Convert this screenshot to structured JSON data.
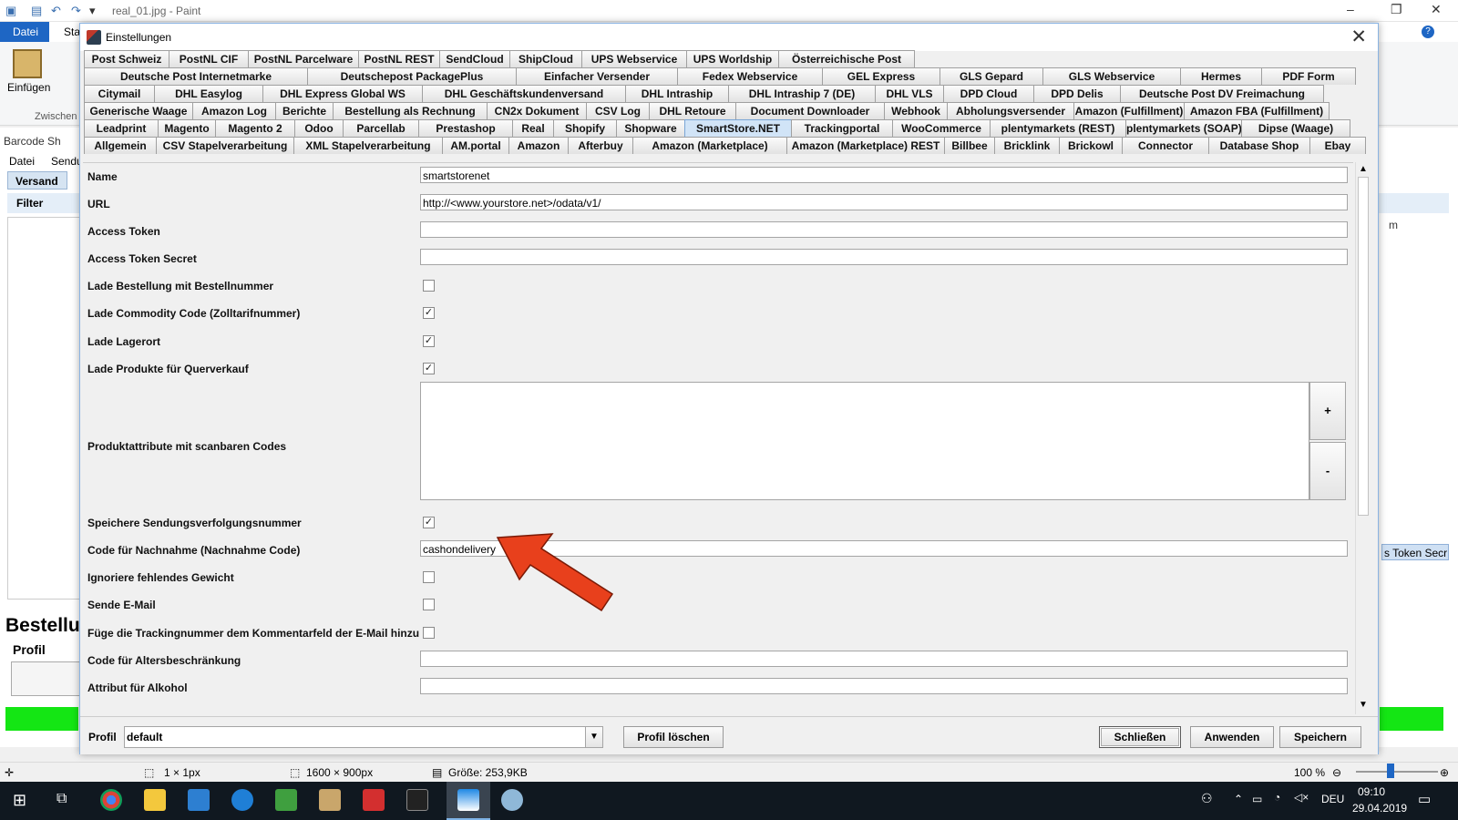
{
  "paint": {
    "window_title": "real_01.jpg - Paint",
    "file_tab": "Datei",
    "start_tab": "Sta",
    "paste_label": "Einfügen",
    "clipboard_group": "Zwischen",
    "status": {
      "selection": "1 × 1px",
      "image_size": "1600 × 900px",
      "file_size": "Größe: 253,9KB",
      "zoom": "100 %"
    }
  },
  "background_app": {
    "title": "Barcode Sh",
    "menu": [
      "Datei",
      "Sendu"
    ],
    "tab_versand": "Versand",
    "filter_label": "Filter",
    "heading": "Bestellu",
    "profil_label": "Profil",
    "token_field_fragment": "s Token Secr",
    "column_fragment": "m"
  },
  "dialog": {
    "title": "Einstellungen",
    "tab_rows": [
      [
        "Post Schweiz",
        "PostNL CIF",
        "PostNL Parcelware",
        "PostNL REST",
        "SendCloud",
        "ShipCloud",
        "UPS Webservice",
        "UPS Worldship",
        "Österreichische Post"
      ],
      [
        "Deutsche Post Internetmarke",
        "Deutschepost PackagePlus",
        "Einfacher Versender",
        "Fedex Webservice",
        "GEL Express",
        "GLS Gepard",
        "GLS Webservice",
        "Hermes",
        "PDF Form"
      ],
      [
        "Citymail",
        "DHL Easylog",
        "DHL Express Global WS",
        "DHL Geschäftskundenversand",
        "DHL Intraship",
        "DHL Intraship 7 (DE)",
        "DHL VLS",
        "DPD Cloud",
        "DPD Delis",
        "Deutsche Post DV Freimachung"
      ],
      [
        "Generische Waage",
        "Amazon Log",
        "Berichte",
        "Bestellung als Rechnung",
        "CN2x Dokument",
        "CSV Log",
        "DHL Retoure",
        "Document Downloader",
        "Webhook",
        "Abholungsversender",
        "Amazon (Fulfillment)",
        "Amazon FBA (Fulfillment)"
      ],
      [
        "Leadprint",
        "Magento",
        "Magento 2",
        "Odoo",
        "Parcellab",
        "Prestashop",
        "Real",
        "Shopify",
        "Shopware",
        "SmartStore.NET",
        "Trackingportal",
        "WooCommerce",
        "plentymarkets (REST)",
        "plentymarkets (SOAP)",
        "Dipse (Waage)"
      ],
      [
        "Allgemein",
        "CSV Stapelverarbeitung",
        "XML Stapelverarbeitung",
        "AM.portal",
        "Amazon",
        "Afterbuy",
        "Amazon (Marketplace)",
        "Amazon (Marketplace) REST",
        "Billbee",
        "Bricklink",
        "Brickowl",
        "Connector",
        "Database Shop",
        "Ebay"
      ]
    ],
    "selected_tab": "SmartStore.NET",
    "fields": {
      "name_label": "Name",
      "name_value": "smartstorenet",
      "url_label": "URL",
      "url_value": "http://<www.yourstore.net>/odata/v1/",
      "access_token_label": "Access Token",
      "access_token_value": "",
      "access_token_secret_label": "Access Token Secret",
      "access_token_secret_value": "",
      "load_by_order_number_label": "Lade Bestellung mit Bestellnummer",
      "load_commodity_label": "Lade Commodity Code (Zolltarifnummer)",
      "load_storage_label": "Lade Lagerort",
      "load_cross_sell_label": "Lade Produkte für Querverkauf",
      "product_attributes_label": "Produktattribute mit scanbaren Codes",
      "add_button": "+",
      "remove_button": "-",
      "save_tracking_label": "Speichere Sendungsverfolgungsnummer",
      "cod_code_label": "Code für Nachnahme (Nachnahme Code)",
      "cod_code_value": "cashondelivery",
      "ignore_weight_label": "Ignoriere fehlendes Gewicht",
      "send_email_label": "Sende E-Mail",
      "add_tracking_comment_label": "Füge die Trackingnummer dem Kommentarfeld der E-Mail hinzu",
      "age_restriction_label": "Code für Altersbeschränkung",
      "age_restriction_value": "",
      "alcohol_attr_label": "Attribut für Alkohol",
      "alcohol_attr_value": ""
    },
    "checkbox_marks": {
      "checked": "✓",
      "load_by_order_number": "",
      "load_commodity": "✓",
      "load_storage": "✓",
      "load_cross_sell": "✓",
      "save_tracking": "✓",
      "ignore_weight": "",
      "send_email": "",
      "add_tracking_comment": ""
    },
    "footer": {
      "profil_label": "Profil",
      "profil_value": "default",
      "delete_profile": "Profil löschen",
      "close": "Schließen",
      "apply": "Anwenden",
      "save": "Speichern"
    },
    "annotation_arrow_color": "#e8401c"
  },
  "taskbar": {
    "language": "DEU",
    "time": "09:10",
    "date": "29.04.2019"
  }
}
